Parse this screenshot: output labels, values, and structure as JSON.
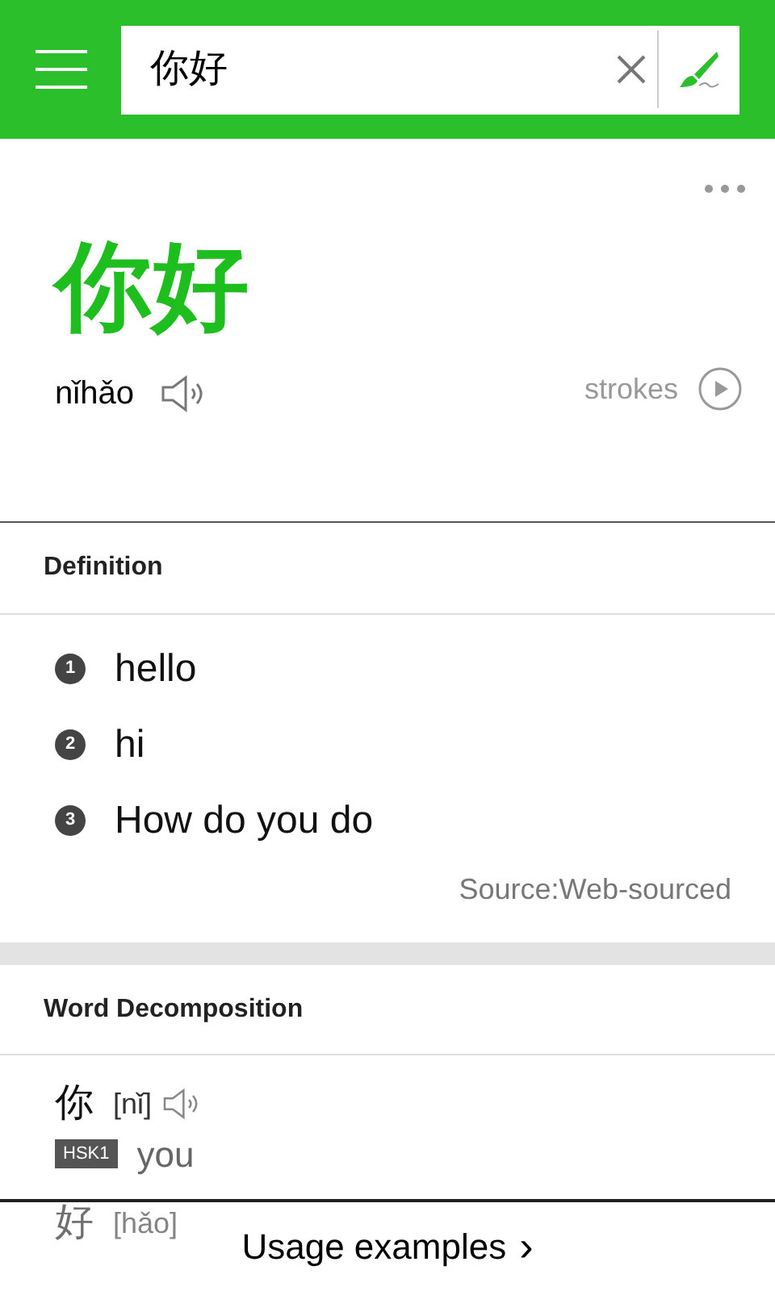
{
  "search": {
    "value": "你好"
  },
  "word": {
    "hanzi": "你好",
    "pinyin": "nǐhǎo",
    "strokes_label": "strokes"
  },
  "definition": {
    "title": "Definition",
    "items": [
      {
        "number": "1",
        "text": "hello"
      },
      {
        "number": "2",
        "text": "hi"
      },
      {
        "number": "3",
        "text": "How do you do"
      }
    ],
    "source": "Source:Web-sourced"
  },
  "decomposition": {
    "title": "Word Decomposition",
    "items": [
      {
        "hanzi": "你",
        "pinyin": "[nǐ]",
        "level": "HSK1",
        "meaning": "you"
      },
      {
        "hanzi": "好",
        "pinyin": "[hǎo]"
      }
    ]
  },
  "bottom_bar": {
    "label": "Usage examples",
    "arrow": "›"
  }
}
